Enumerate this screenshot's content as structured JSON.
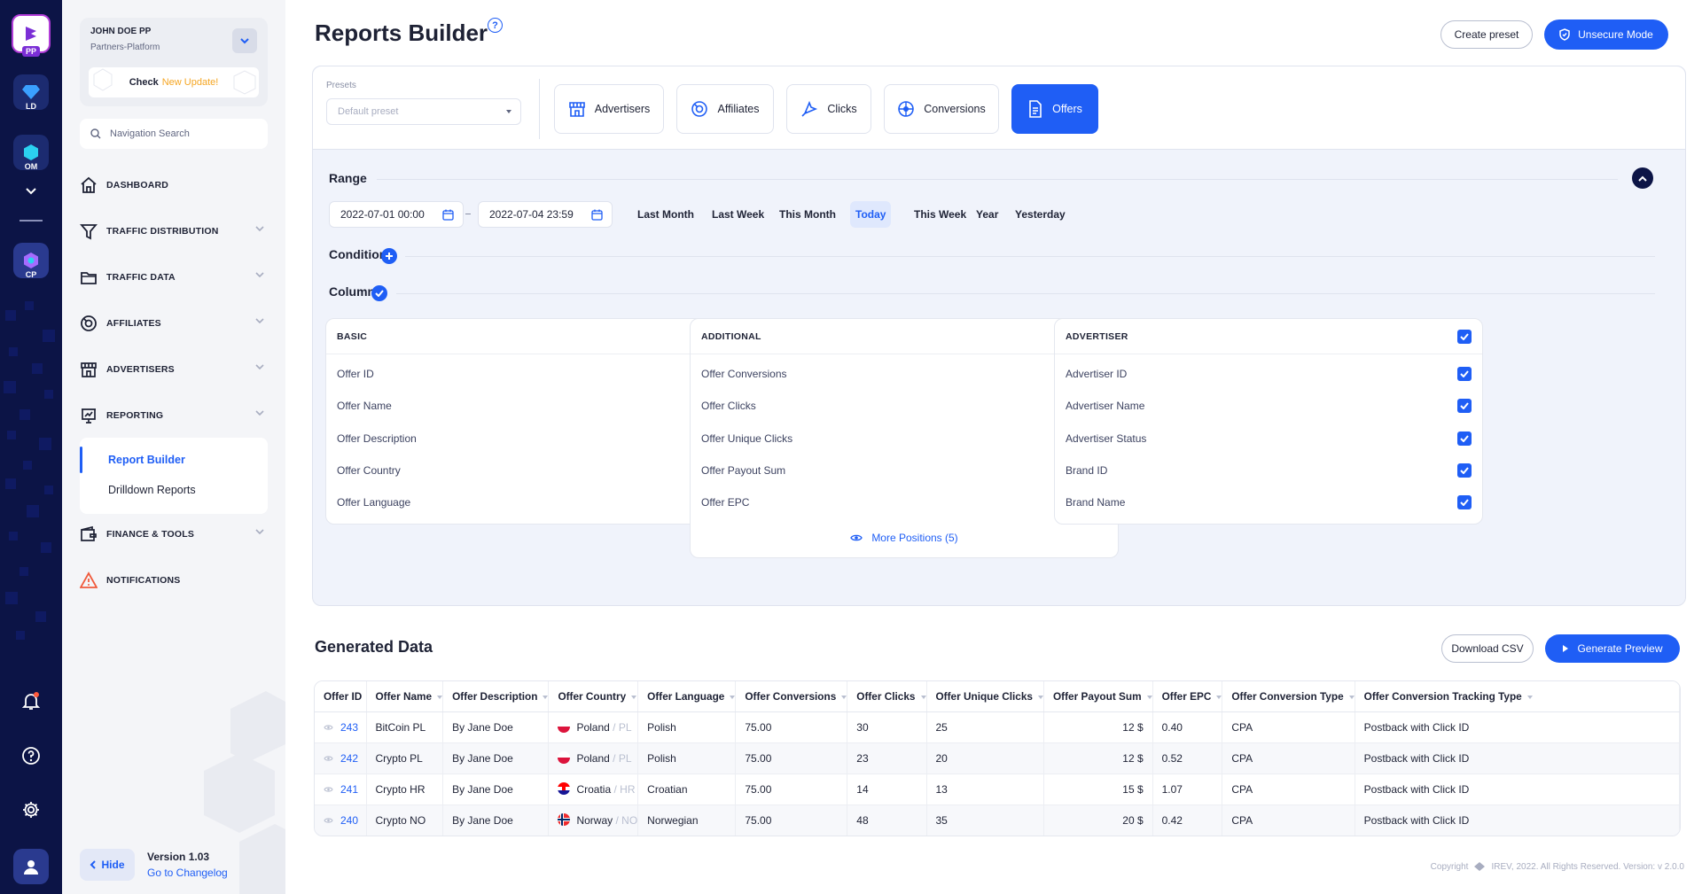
{
  "app_rail": {
    "apps": [
      {
        "code": "PP",
        "icon": "pp-logo-icon"
      },
      {
        "code": "LD",
        "icon": "ld-diamond-icon"
      },
      {
        "code": "OM",
        "icon": "om-hex-icon"
      },
      {
        "code": "CP",
        "icon": "cp-logo-icon"
      }
    ],
    "bottom_icons": [
      "bell-icon",
      "help-icon",
      "settings-icon",
      "user-icon"
    ]
  },
  "sidebar": {
    "user_name": "JOHN DOE PP",
    "org": "Partners-Platform",
    "update_prefix": "Check",
    "update_highlight": "New Update!",
    "search_placeholder": "Navigation Search",
    "menu": [
      {
        "label": "DASHBOARD",
        "icon": "home-icon",
        "has_chevron": false
      },
      {
        "label": "TRAFFIC DISTRIBUTION",
        "icon": "funnel-icon",
        "has_chevron": true
      },
      {
        "label": "TRAFFIC DATA",
        "icon": "folder-icon",
        "has_chevron": true
      },
      {
        "label": "AFFILIATES",
        "icon": "affiliates-icon",
        "has_chevron": true
      },
      {
        "label": "ADVERTISERS",
        "icon": "storefront-icon",
        "has_chevron": true
      },
      {
        "label": "REPORTING",
        "icon": "presentation-icon",
        "has_chevron": true
      },
      {
        "label": "FINANCE & TOOLS",
        "icon": "wallet-icon",
        "has_chevron": true
      },
      {
        "label": "NOTIFICATIONS",
        "icon": "warning-icon",
        "has_chevron": false
      }
    ],
    "reporting_sub": [
      {
        "label": "Report Builder",
        "active": true
      },
      {
        "label": "Drilldown Reports",
        "active": false
      }
    ],
    "hide_label": "Hide",
    "version": "Version 1.03",
    "changelog": "Go to Changelog"
  },
  "header": {
    "title": "Reports Builder",
    "create_preset": "Create preset",
    "unsecure_mode": "Unsecure Mode"
  },
  "builder": {
    "presets_label": "Presets",
    "preset_placeholder": "Default preset",
    "entities": [
      {
        "label": "Advertisers",
        "icon": "advertisers-icon",
        "active": false
      },
      {
        "label": "Affiliates",
        "icon": "affiliates-icon",
        "active": false
      },
      {
        "label": "Clicks",
        "icon": "cursor-click-icon",
        "active": false
      },
      {
        "label": "Conversions",
        "icon": "conversions-icon",
        "active": false
      },
      {
        "label": "Offers",
        "icon": "document-icon",
        "active": true
      }
    ],
    "range_label": "Range",
    "date_from": "2022-07-01 00:00",
    "date_to": "2022-07-04 23:59",
    "quick_ranges": [
      {
        "label": "Last Month",
        "active": false
      },
      {
        "label": "Last Week",
        "active": false
      },
      {
        "label": "This Month",
        "active": false
      },
      {
        "label": "Today",
        "active": true
      },
      {
        "label": "This Week",
        "active": false
      },
      {
        "label": "Year",
        "active": false
      },
      {
        "label": "Yesterday",
        "active": false
      }
    ],
    "conditions_label": "Conditions",
    "columns_label": "Columns",
    "column_groups": [
      {
        "title": "BASIC",
        "items": [
          "Offer ID",
          "Offer Name",
          "Offer Description",
          "Offer Country",
          "Offer Language"
        ],
        "more": ""
      },
      {
        "title": "ADDITIONAL",
        "items": [
          "Offer Conversions",
          "Offer Clicks",
          "Offer Unique Clicks",
          "Offer Payout Sum",
          "Offer EPC"
        ],
        "more": "More Positions (5)"
      },
      {
        "title": "ADVERTISER",
        "items": [
          "Advertiser ID",
          "Advertiser Name",
          "Advertiser Status",
          "Brand ID",
          "Brand Name"
        ],
        "more": ""
      }
    ]
  },
  "generated": {
    "title": "Generated Data",
    "download_csv": "Download CSV",
    "generate_preview": "Generate Preview",
    "columns": [
      "Offer ID",
      "Offer Name",
      "Offer Description",
      "Offer Country",
      "Offer Language",
      "Offer Conversions",
      "Offer Clicks",
      "Offer Unique Clicks",
      "Offer Payout Sum",
      "Offer EPC",
      "Offer Conversion Type",
      "Offer Conversion Tracking Type"
    ],
    "rows": [
      {
        "id": "243",
        "name": "BitCoin PL",
        "desc": "By Jane Doe",
        "country": "Poland",
        "cc": "/ PL",
        "flag": "poland-flag-icon",
        "lang": "Polish",
        "conv": "75.00",
        "clicks": "30",
        "uniq": "25",
        "payout": "12 $",
        "epc": "0.40",
        "type": "CPA",
        "tracking": "Postback with Click ID"
      },
      {
        "id": "242",
        "name": "Crypto PL",
        "desc": "By Jane Doe",
        "country": "Poland",
        "cc": "/ PL",
        "flag": "poland-flag-icon",
        "lang": "Polish",
        "conv": "75.00",
        "clicks": "23",
        "uniq": "20",
        "payout": "12 $",
        "epc": "0.52",
        "type": "CPA",
        "tracking": "Postback with Click ID"
      },
      {
        "id": "241",
        "name": "Crypto HR",
        "desc": "By Jane Doe",
        "country": "Croatia",
        "cc": "/ HR",
        "flag": "croatia-flag-icon",
        "lang": "Croatian",
        "conv": "75.00",
        "clicks": "14",
        "uniq": "13",
        "payout": "15 $",
        "epc": "1.07",
        "type": "CPA",
        "tracking": "Postback with Click ID"
      },
      {
        "id": "240",
        "name": "Crypto NO",
        "desc": "By Jane Doe",
        "country": "Norway",
        "cc": "/ NO",
        "flag": "norway-flag-icon",
        "lang": "Norwegian",
        "conv": "75.00",
        "clicks": "48",
        "uniq": "35",
        "payout": "20 $",
        "epc": "0.42",
        "type": "CPA",
        "tracking": "Postback with Click ID"
      }
    ]
  },
  "footer": {
    "copyright": "Copyright",
    "brand_text": "IREV, 2022. All Rights Reserved. Version: v 2.0.0"
  },
  "colors": {
    "accent": "#1f5ef5",
    "rail": "#0c1446",
    "update_highlight": "#f5a623"
  }
}
